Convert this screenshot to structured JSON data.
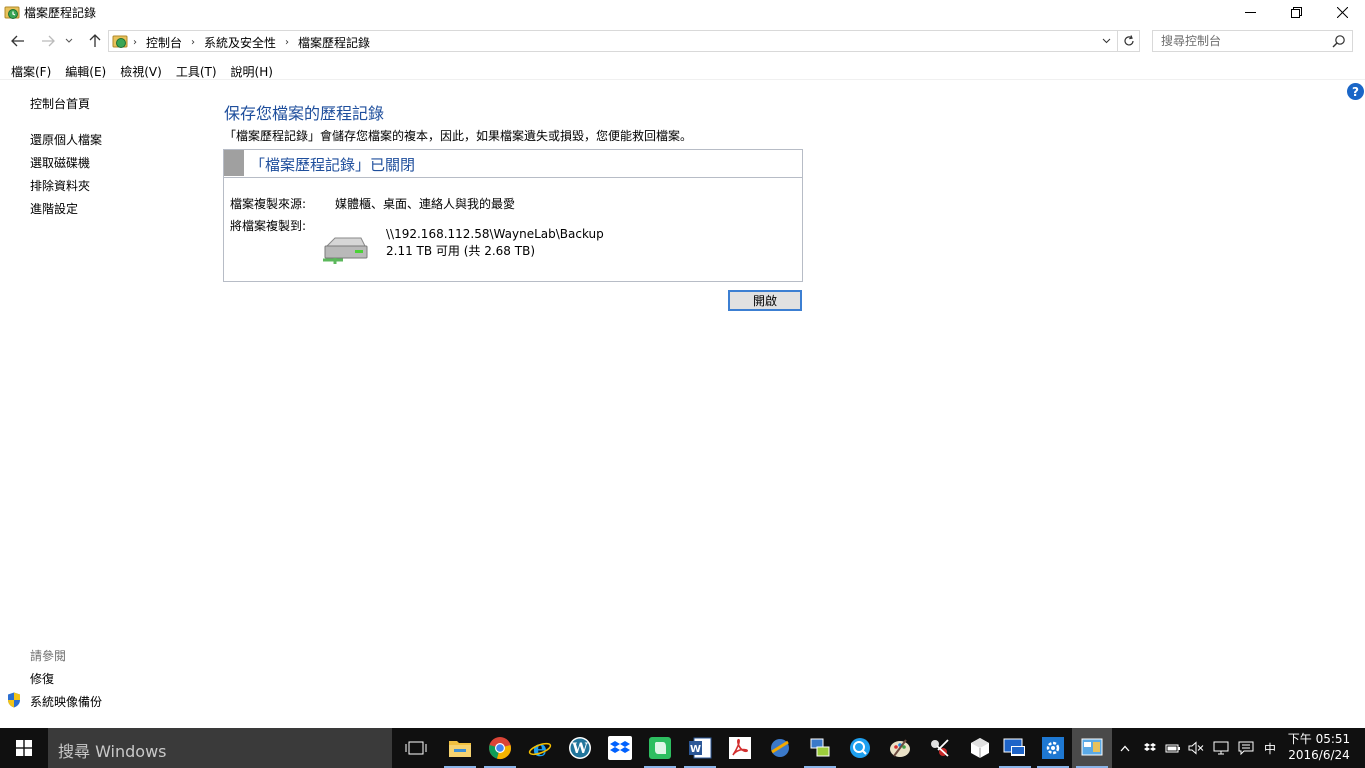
{
  "window": {
    "title": "檔案歷程記錄"
  },
  "breadcrumbs": [
    "控制台",
    "系統及安全性",
    "檔案歷程記錄"
  ],
  "search": {
    "placeholder": "搜尋控制台"
  },
  "menu": [
    "檔案(F)",
    "編輯(E)",
    "檢視(V)",
    "工具(T)",
    "說明(H)"
  ],
  "sidebar": {
    "items": [
      {
        "label": "控制台首頁"
      },
      {
        "label": "還原個人檔案"
      },
      {
        "label": "選取磁碟機"
      },
      {
        "label": "排除資料夾"
      },
      {
        "label": "進階設定"
      }
    ],
    "see_also": "請參閱",
    "see_also_items": [
      {
        "label": "修復"
      },
      {
        "label": "系統映像備份"
      }
    ]
  },
  "main": {
    "title": "保存您檔案的歷程記錄",
    "description": "「檔案歷程記錄」會儲存您檔案的複本，因此，如果檔案遺失或損毀，您便能救回檔案。",
    "status_header": "「檔案歷程記錄」已關閉",
    "source_label": "檔案複製來源:",
    "source_value": "媒體櫃、桌面、連絡人與我的最愛",
    "dest_label": "將檔案複製到:",
    "dest_path": "\\\\192.168.112.58\\WayneLab\\Backup",
    "dest_space": "2.11 TB 可用 (共 2.68 TB)",
    "turn_on_button": "開啟"
  },
  "taskbar": {
    "search_text": "搜尋 Windows",
    "apps": [
      {
        "name": "task-view",
        "icon": "task-view-icon"
      },
      {
        "name": "file-explorer",
        "icon": "folder-icon",
        "color": "#f0c040"
      },
      {
        "name": "chrome",
        "icon": "chrome-icon"
      },
      {
        "name": "internet-explorer",
        "icon": "ie-icon",
        "color": "#1ea0f0"
      },
      {
        "name": "wordpress",
        "icon": "wordpress-icon",
        "color": "#21759b"
      },
      {
        "name": "dropbox",
        "icon": "dropbox-icon",
        "color": "#0061fe"
      },
      {
        "name": "evernote",
        "icon": "evernote-icon",
        "color": "#2dbe60"
      },
      {
        "name": "word",
        "icon": "word-icon",
        "color": "#2b5797"
      },
      {
        "name": "acrobat",
        "icon": "acrobat-icon",
        "color": "#d32f2f"
      }
    ],
    "ime": "中",
    "clock_time": "下午 05:51",
    "clock_date": "2016/6/24"
  },
  "colors": {
    "accent_blue": "#1e4e9c",
    "button_border": "#3c7fd2",
    "taskbar_bg": "#101010"
  }
}
